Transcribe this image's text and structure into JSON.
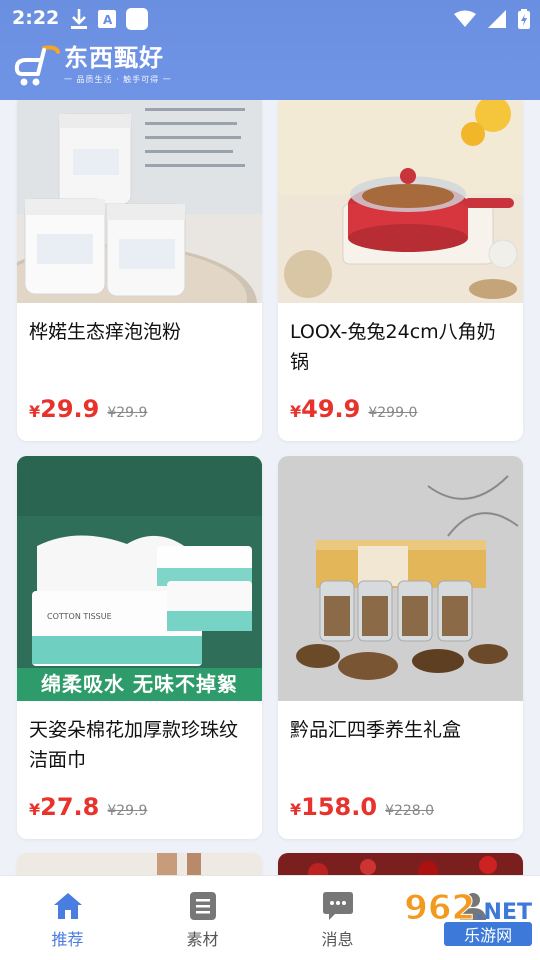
{
  "status_bar": {
    "time": "2:22"
  },
  "app": {
    "brand": "东西甄好",
    "tagline": "一 品质生活 · 触手可得 一"
  },
  "products": [
    {
      "title": "桦婼生态痒泡泡粉",
      "price": "29.9",
      "old_price": "¥29.9",
      "currency": "¥"
    },
    {
      "title": "LOOX-兔兔24cm八角奶锅",
      "price": "49.9",
      "old_price": "¥299.0",
      "currency": "¥"
    },
    {
      "title": "天姿朵棉花加厚款珍珠纹洁面巾",
      "price": "27.8",
      "old_price": "¥29.9",
      "currency": "¥",
      "image_text": "绵柔吸水 无味不掉絮",
      "package_text": "COTTON TISSUE"
    },
    {
      "title": "黔品汇四季养生礼盒",
      "price": "158.0",
      "old_price": "¥228.0",
      "currency": "¥"
    }
  ],
  "nav": [
    {
      "label": "推荐",
      "icon": "home-icon",
      "active": true
    },
    {
      "label": "素材",
      "icon": "document-icon",
      "active": false
    },
    {
      "label": "消息",
      "icon": "message-icon",
      "active": false
    },
    {
      "label": "",
      "icon": "profile-icon",
      "active": false
    }
  ],
  "watermark": {
    "text1": "962",
    "text2": ".NET",
    "text3": "乐游网"
  },
  "colors": {
    "header": "#6b8fe0",
    "accent": "#4a7de0",
    "price": "#e8322c"
  }
}
